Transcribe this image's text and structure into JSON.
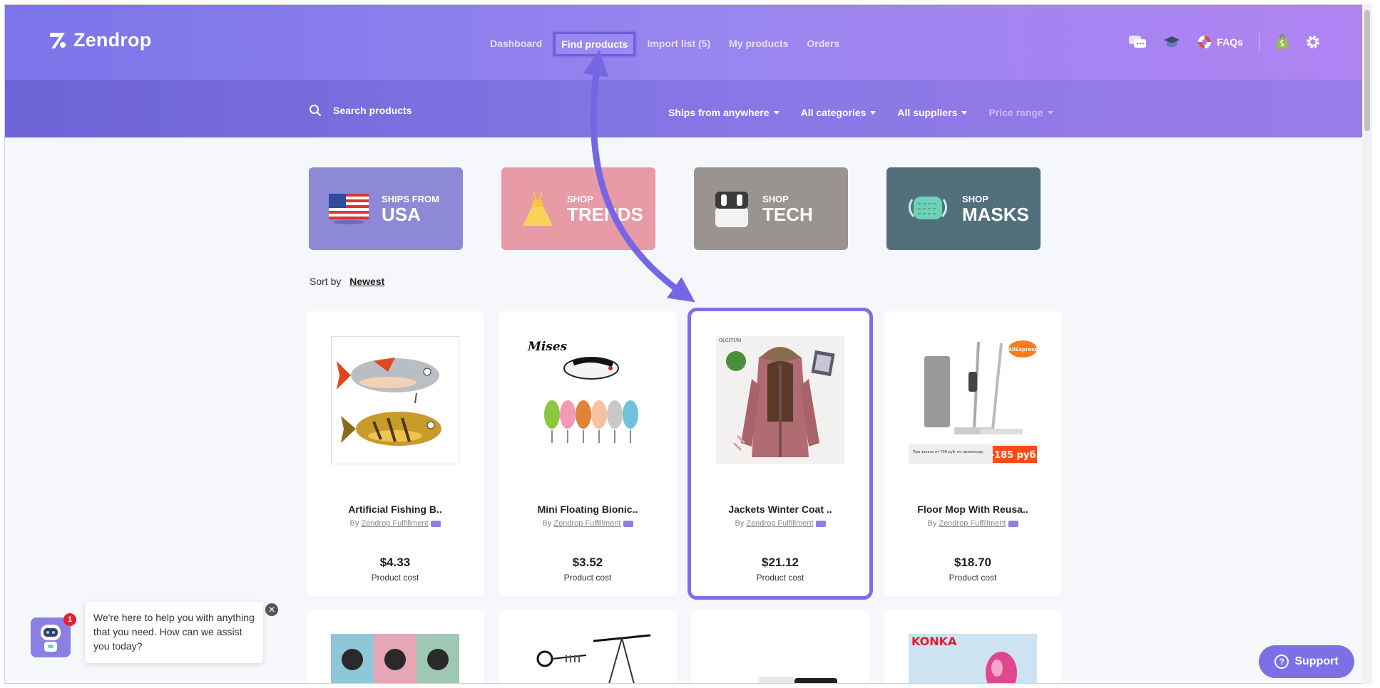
{
  "brand": {
    "name": "Zendrop"
  },
  "nav": {
    "items": [
      {
        "label": "Dashboard"
      },
      {
        "label": "Find products"
      },
      {
        "label": "Import list (5)"
      },
      {
        "label": "My products"
      },
      {
        "label": "Orders"
      }
    ],
    "active_index": 1
  },
  "header_right": {
    "faqs_label": "FAQs"
  },
  "search": {
    "placeholder": "Search products"
  },
  "filters": [
    {
      "label": "Ships from anywhere"
    },
    {
      "label": "All categories"
    },
    {
      "label": "All suppliers"
    },
    {
      "label": "Price range"
    }
  ],
  "banners": [
    {
      "small": "SHIPS FROM",
      "big": "USA"
    },
    {
      "small": "SHOP",
      "big": "TRENDS"
    },
    {
      "small": "SHOP",
      "big": "TECH"
    },
    {
      "small": "SHOP",
      "big": "MASKS"
    }
  ],
  "sort": {
    "label": "Sort by",
    "value": "Newest"
  },
  "products": [
    {
      "title": "Artificial Fishing B..",
      "by": "By",
      "supplier": "Zendrop Fulfillment",
      "price": "$4.33",
      "price_label": "Product cost"
    },
    {
      "title": "Mini Floating Bionic..",
      "by": "By",
      "supplier": "Zendrop Fulfillment",
      "price": "$3.52",
      "price_label": "Product cost"
    },
    {
      "title": "Jackets Winter Coat ..",
      "by": "By",
      "supplier": "Zendrop Fulfillment",
      "price": "$21.12",
      "price_label": "Product cost"
    },
    {
      "title": "Floor Mop With Reusa..",
      "by": "By",
      "supplier": "Zendrop Fulfillment",
      "price": "$18.70",
      "price_label": "Product cost"
    }
  ],
  "product_image_text": {
    "mises": "Mises",
    "olgitum": "OLGITUM",
    "mop_sticker": "AliExpress",
    "mop_promo": "-185 руб.",
    "mop_fine": "При заказе от 799 руб. по промокоду",
    "konka": "KONKA"
  },
  "chat": {
    "badge": "1",
    "message": "We're here to help you with anything that you need. How can we assist you today?"
  },
  "support": {
    "label": "Support"
  },
  "colors": {
    "accent": "#7e6fe6",
    "header_start": "#7b74ea",
    "header_end": "#b083f3"
  }
}
